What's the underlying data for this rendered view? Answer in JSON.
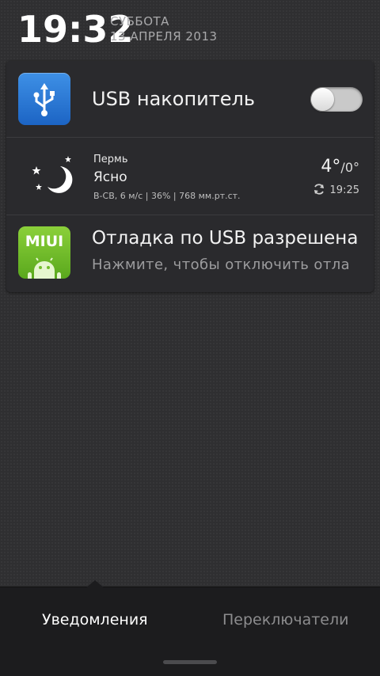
{
  "header": {
    "time": "19:32",
    "day_of_week": "СУББОТА",
    "date": "13 АПРЕЛЯ 2013"
  },
  "notifications": {
    "usb_storage": {
      "label": "USB накопитель",
      "icon": "usb-icon",
      "toggle_on": false
    },
    "weather": {
      "city": "Пермь",
      "condition": "Ясно",
      "details": "В-СВ, 6 м/с | 36% | 768 мм.рт.ст.",
      "temp_high": "4°",
      "temp_sep": "/",
      "temp_low": "0°",
      "updated": "19:25",
      "icon": "moon-stars-icon"
    },
    "usb_debug": {
      "title": "Отладка по USB разрешена",
      "subtitle": "Нажмите, чтобы отключить отла",
      "icon_text": "MIUI",
      "icon": "miui-android-icon"
    }
  },
  "tabs": {
    "notifications": "Уведомления",
    "switches": "Переключатели"
  },
  "colors": {
    "usb_icon_bg": "#2b7bd6",
    "miui_icon_bg": "#72bd2a",
    "active_tab": "#ffffff",
    "inactive_tab": "#8c8c8e"
  }
}
